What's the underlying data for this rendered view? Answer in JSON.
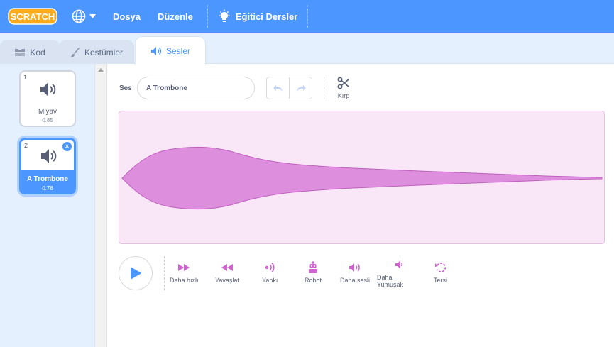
{
  "menubar": {
    "logo_text": "SCRATCH",
    "file_label": "Dosya",
    "edit_label": "Düzenle",
    "tutorials_label": "Eğitici Dersler"
  },
  "tabs": {
    "code_label": "Kod",
    "costumes_label": "Kostümler",
    "sounds_label": "Sesler"
  },
  "sounds": [
    {
      "number": "1",
      "name": "Miyav",
      "duration": "0.85"
    },
    {
      "number": "2",
      "name": "A Trombone",
      "duration": "0.78"
    }
  ],
  "editor": {
    "sound_label": "Ses",
    "sound_name_value": "A Trombone",
    "trim_label": "Kırp"
  },
  "effects": [
    {
      "icon": "faster-icon",
      "label": "Daha hızlı"
    },
    {
      "icon": "slower-icon",
      "label": "Yavaşlat"
    },
    {
      "icon": "echo-icon",
      "label": "Yankı"
    },
    {
      "icon": "robot-icon",
      "label": "Robot"
    },
    {
      "icon": "louder-icon",
      "label": "Daha sesli"
    },
    {
      "icon": "softer-icon",
      "label": "Daha Yumuşak"
    },
    {
      "icon": "reverse-icon",
      "label": "Tersi"
    }
  ],
  "colors": {
    "menu_blue": "#4c97ff",
    "sound_purple": "#cf63cf",
    "wave_fill": "#dd8fdd",
    "wave_bg": "#f9e6f6"
  }
}
